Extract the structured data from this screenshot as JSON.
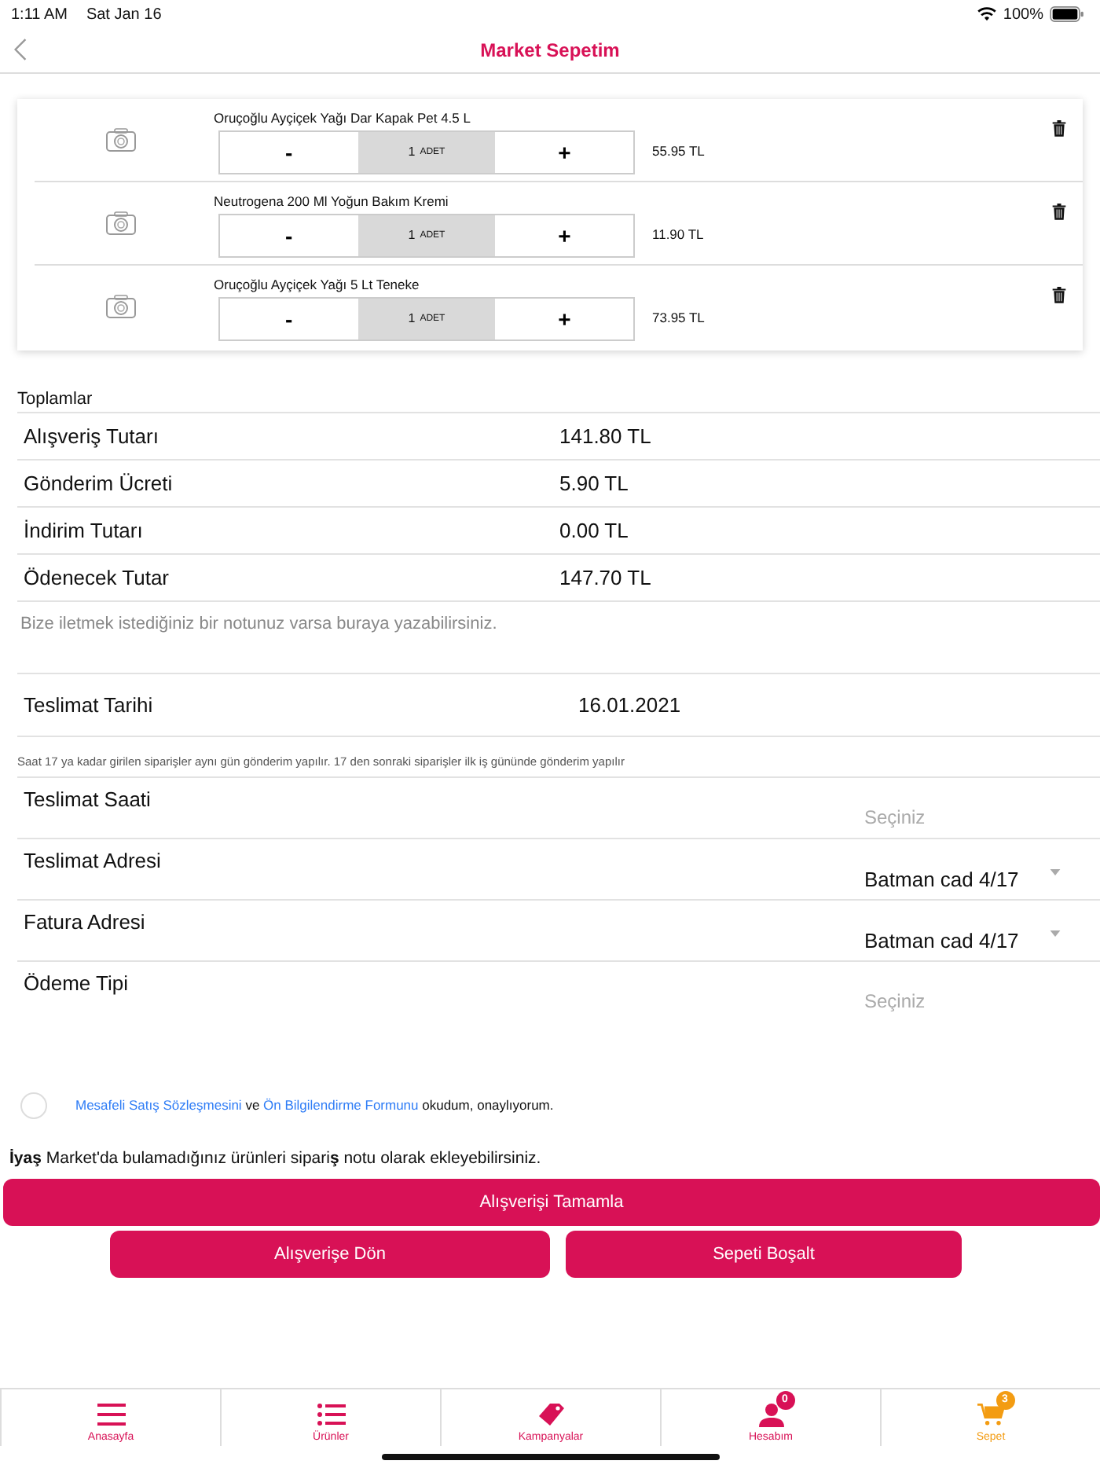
{
  "status_bar": {
    "time": "1:11 AM",
    "date": "Sat Jan 16",
    "battery": "100%"
  },
  "nav": {
    "title": "Market Sepetim"
  },
  "cart_items": [
    {
      "name": "Oruçoğlu Ayçiçek Yağı Dar Kapak Pet 4.5 L",
      "minus": "-",
      "quantity": "1",
      "unit": "ADET",
      "plus": "+",
      "price": "55.95 TL"
    },
    {
      "name": "Neutrogena 200 Ml Yoğun Bakım Kremi",
      "minus": "-",
      "quantity": "1",
      "unit": "ADET",
      "plus": "+",
      "price": "11.90 TL"
    },
    {
      "name": "Oruçoğlu Ayçiçek Yağı 5 Lt Teneke",
      "minus": "-",
      "quantity": "1",
      "unit": "ADET",
      "plus": "+",
      "price": "73.95 TL"
    }
  ],
  "totals": {
    "heading": "Toplamlar",
    "rows": [
      {
        "label": "Alışveriş Tutarı",
        "value": "141.80 TL"
      },
      {
        "label": "Gönderim Ücreti",
        "value": "5.90 TL"
      },
      {
        "label": "İndirim Tutarı",
        "value": "0.00 TL"
      },
      {
        "label": "Ödenecek Tutar",
        "value": "147.70 TL"
      }
    ]
  },
  "note_field": {
    "placeholder": "Bize iletmek istediğiniz bir notunuz varsa buraya yazabilirsiniz."
  },
  "delivery_date": {
    "label": "Teslimat Tarihi",
    "value": "16.01.2021"
  },
  "delivery_info": "Saat 17 ya kadar girilen siparişler aynı gün gönderim yapılır. 17 den sonraki siparişler ilk iş gününde gönderim yapılır",
  "selects": [
    {
      "label": "Teslimat Saati",
      "placeholder": "Seçiniz"
    },
    {
      "label": "Teslimat Adresi",
      "value": "Batman cad 4/17"
    },
    {
      "label": "Fatura Adresi",
      "value": "Batman cad 4/17"
    },
    {
      "label": "Ödeme Tipi",
      "placeholder": "Seçiniz"
    }
  ],
  "agreement": {
    "checked": false,
    "link_1": "Mesafeli Satış Sözleşmesini",
    "joiner": "ve",
    "link_2": "Ön Bilgilendirme Formunu",
    "suffix": "okudum, onaylıyorum."
  },
  "order_note": "**İyaş** Market'da bulamadığınız ürünleri sipari**ş** notu olarak ekleyebilirsiniz.",
  "buttons": {
    "primary": "Alışverişi Tamamla",
    "secondary": [
      "Alışverişe Dön",
      "Sepeti Boşalt"
    ]
  },
  "tab_bar": [
    {
      "kind": "menu",
      "label": "Anasayfa",
      "selected": false
    },
    {
      "kind": "list",
      "label": "Ürünler",
      "selected": false
    },
    {
      "kind": "tag",
      "label": "Kampanyalar",
      "selected": false
    },
    {
      "kind": "user",
      "label": "Hesabım",
      "badge": "0",
      "selected": false
    },
    {
      "kind": "cart",
      "label": "Sepet",
      "badge": "3",
      "selected": true
    }
  ]
}
